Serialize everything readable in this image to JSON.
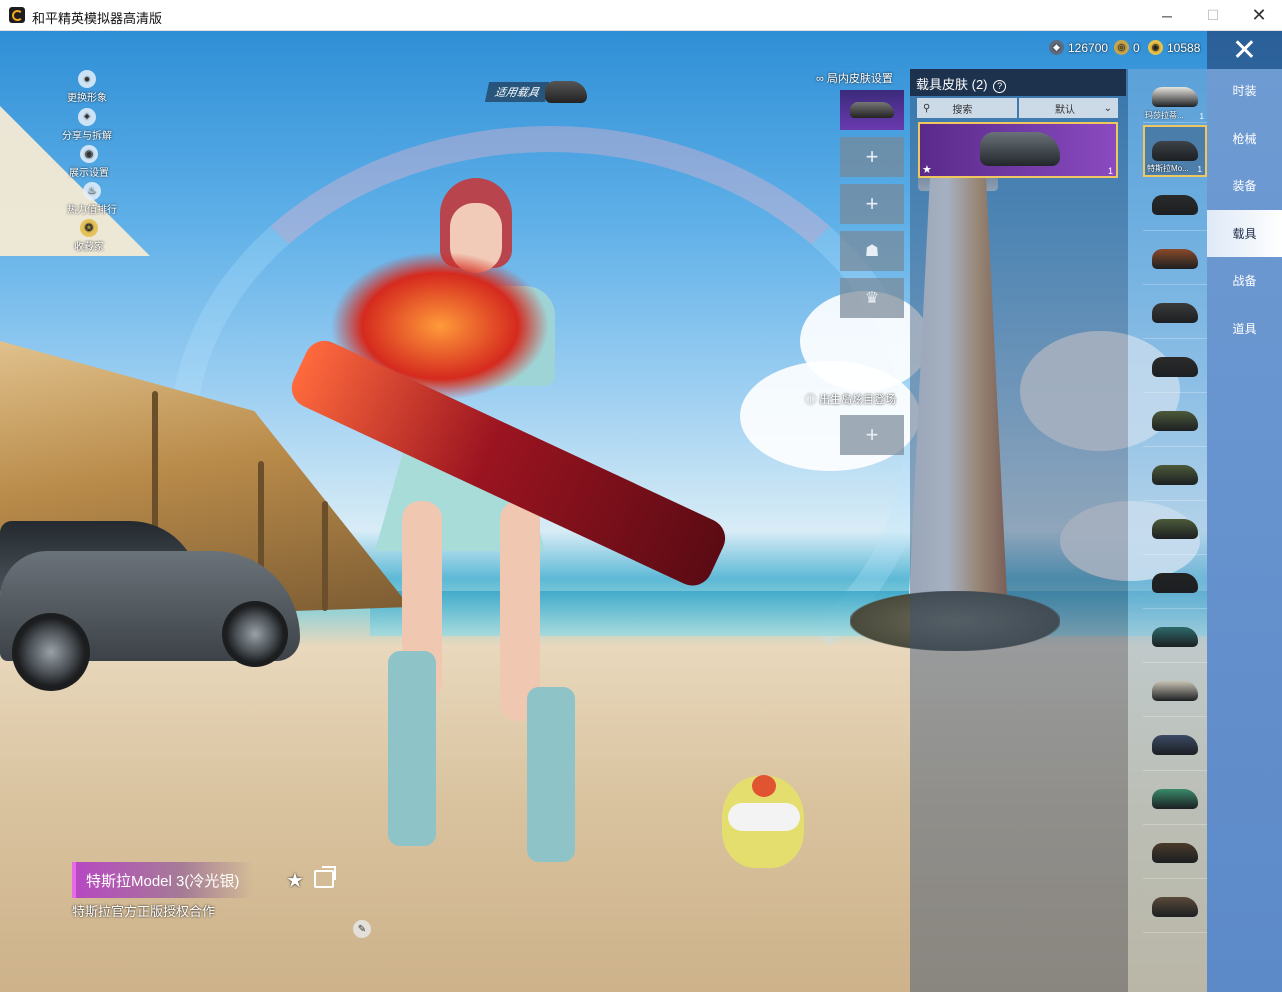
{
  "window": {
    "title": "和平精英模拟器高清版",
    "minimize": "─",
    "maximize": "☐",
    "close": "✕"
  },
  "left_menu": [
    {
      "label": "更换形象",
      "icon": "avatar-icon"
    },
    {
      "label": "分享与拆解",
      "icon": "share-icon"
    },
    {
      "label": "展示设置",
      "icon": "eye-icon"
    },
    {
      "label": "热力值排行",
      "icon": "flame-icon"
    },
    {
      "label": "收藏家",
      "icon": "badge-icon"
    }
  ],
  "apply_vehicle": {
    "label": "适用载具"
  },
  "currency": [
    {
      "value": "126700",
      "icon": "silver-coin-icon",
      "color": "#5d6b80"
    },
    {
      "value": "0",
      "icon": "gold-ticket-icon",
      "color": "#c9a64a"
    },
    {
      "value": "10588",
      "icon": "gold-coin-icon",
      "color": "#e8c24a"
    }
  ],
  "close_button": {
    "glyph": "✕"
  },
  "categories": [
    {
      "label": "时装",
      "active": false
    },
    {
      "label": "枪械",
      "active": false
    },
    {
      "label": "装备",
      "active": false
    },
    {
      "label": "载具",
      "active": true
    },
    {
      "label": "战备",
      "active": false
    },
    {
      "label": "道具",
      "active": false
    }
  ],
  "vehicles": [
    {
      "label": "玛莎拉蒂...",
      "count": "1",
      "selected": false,
      "color": "#e7e4de"
    },
    {
      "label": "特斯拉Mo...",
      "count": "1",
      "selected": true,
      "color": "#3d4349"
    },
    {
      "label": "",
      "count": "",
      "selected": false,
      "color": "#2a2a2a"
    },
    {
      "label": "",
      "count": "",
      "selected": false,
      "color": "#8a4a2a"
    },
    {
      "label": "",
      "count": "",
      "selected": false,
      "color": "#3a3a3a"
    },
    {
      "label": "",
      "count": "",
      "selected": false,
      "color": "#2b2b2b"
    },
    {
      "label": "",
      "count": "",
      "selected": false,
      "color": "#4c5a3a"
    },
    {
      "label": "",
      "count": "",
      "selected": false,
      "color": "#4c5a3a"
    },
    {
      "label": "",
      "count": "",
      "selected": false,
      "color": "#4c5a3a"
    },
    {
      "label": "",
      "count": "",
      "selected": false,
      "color": "#222222"
    },
    {
      "label": "",
      "count": "",
      "selected": false,
      "color": "#2e6a6a"
    },
    {
      "label": "",
      "count": "",
      "selected": false,
      "color": "#c9c2b4"
    },
    {
      "label": "",
      "count": "",
      "selected": false,
      "color": "#3c4a66"
    },
    {
      "label": "",
      "count": "",
      "selected": false,
      "color": "#3a8a6a"
    },
    {
      "label": "",
      "count": "",
      "selected": false,
      "color": "#4a3a2a"
    },
    {
      "label": "",
      "count": "",
      "selected": false,
      "color": "#5a4a3a"
    }
  ],
  "skin_panel": {
    "title": "载具皮肤 (2)",
    "help": "?",
    "search_label": "搜索",
    "sort_label": "默认",
    "card_count": "1"
  },
  "slots": {
    "in_game_title": "局内皮肤设置",
    "birth_title": "出生岛炫目登场",
    "plus": "+"
  },
  "item": {
    "name": "特斯拉Model 3(冷光银)",
    "description": "特斯拉官方正版授权合作"
  }
}
